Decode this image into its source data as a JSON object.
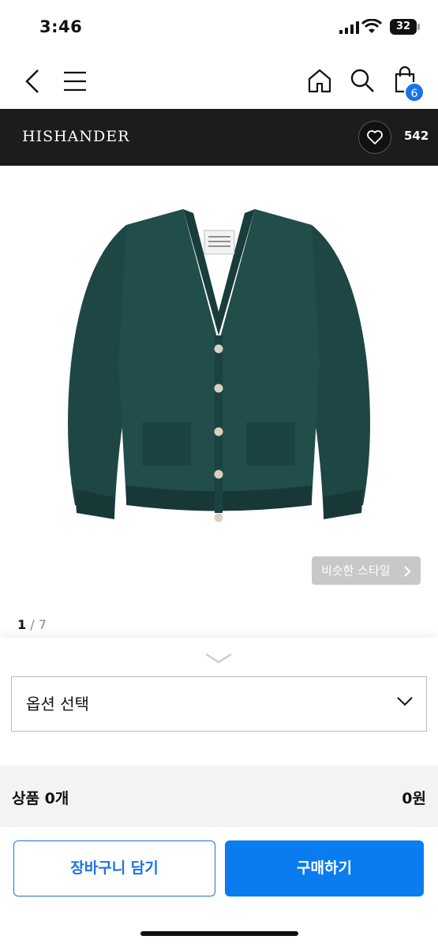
{
  "status_bar": {
    "time": "3:46",
    "battery": "32"
  },
  "nav": {
    "cart_count": "6"
  },
  "brand": {
    "name": "HISHANDER",
    "like_count": "542"
  },
  "product": {
    "similar_style_label": "비슷한 스타일",
    "pager_current": "1",
    "pager_separator": " / ",
    "pager_total": "7"
  },
  "options": {
    "select_placeholder": "옵션 선택",
    "summary_label": "상품 0개",
    "summary_price": "0원",
    "add_to_cart": "장바구니 담기",
    "buy_now": "구매하기"
  },
  "colors": {
    "accent": "#0b7cf0",
    "brand_bar": "#1c1c1c",
    "cardigan": "#1f4a48"
  }
}
